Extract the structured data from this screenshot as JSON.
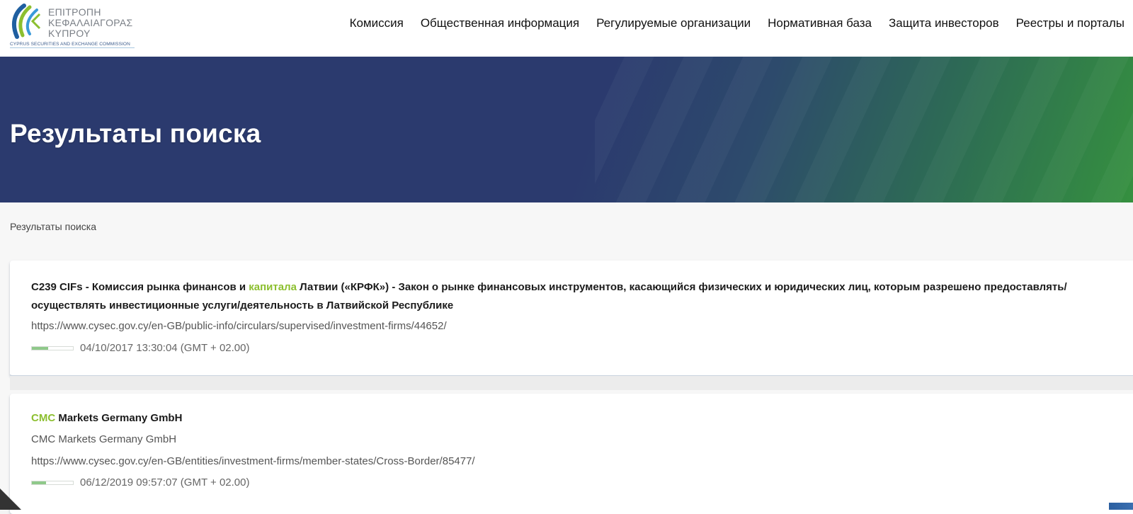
{
  "logo": {
    "lines": [
      "ΕΠΙΤΡΟΠΗ",
      "ΚΕΦΑΛΑΙΑΓΟΡΑΣ",
      "ΚΥΠΡΟΥ"
    ],
    "sub": "CYPRUS SECURITIES AND EXCHANGE COMMISSION",
    "colors": [
      "#1f5fa0",
      "#8cbf2f",
      "#3a9ad9"
    ]
  },
  "nav": {
    "items": [
      "Комиссия",
      "Общественная информация",
      "Регулируемые организации",
      "Нормативная база",
      "Защита инвесторов",
      "Реестры и порталы"
    ]
  },
  "hero": {
    "title": "Результаты поиска"
  },
  "breadcrumb": "Результаты поиска",
  "results": [
    {
      "title_parts": [
        "C239 CIFs - Комиссия рынка финансов и ",
        "капитала",
        " Латвии («КРФК») - Закон о рынке финансовых инструментов, касающийся физических и юридических лиц, которым разрешено предоставлять/осуществлять инвестиционные услуги/деятельность в Латвийской Республике"
      ],
      "url": "https://www.cysec.gov.cy/en-GB/public-info/circulars/supervised/investment-firms/44652/",
      "relevance": 0.4,
      "date": "04/10/2017 13:30:04 (GMT + 02.00)"
    },
    {
      "title_parts": [
        "CMC",
        " Markets Germany GmbH"
      ],
      "subtitle": "CMC Markets Germany GmbH",
      "url": "https://www.cysec.gov.cy/en-GB/entities/investment-firms/member-states/Cross-Border/85477/",
      "relevance": 0.35,
      "date": "06/12/2019 09:57:07 (GMT + 02.00)"
    }
  ],
  "colors": {
    "highlight": "#8cbf2f",
    "hero_start": "#2b3a6e",
    "hero_end": "#35903f"
  }
}
